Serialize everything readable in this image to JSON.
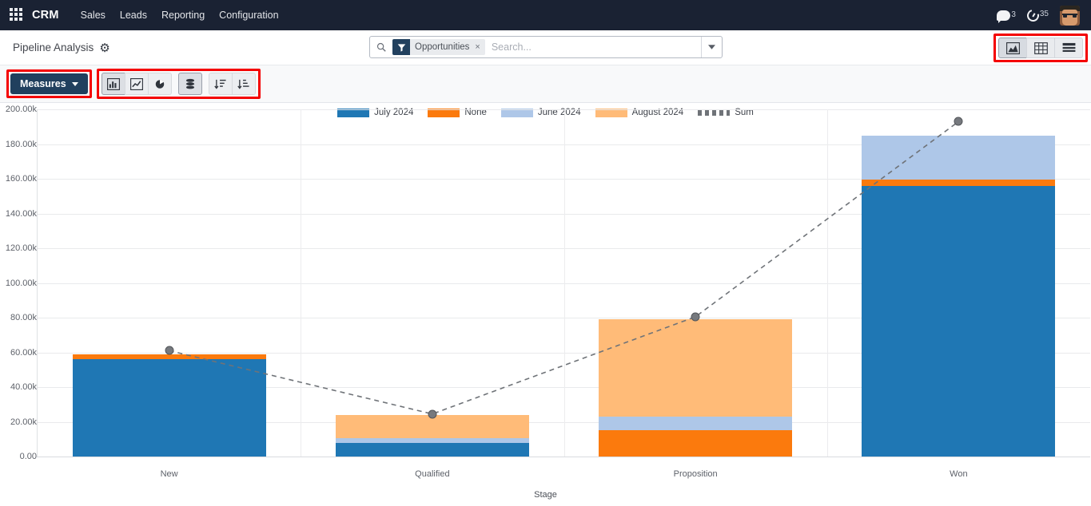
{
  "navbar": {
    "apps_icon": "apps-grid-icon",
    "brand": "CRM",
    "menu": [
      {
        "label": "Sales"
      },
      {
        "label": "Leads"
      },
      {
        "label": "Reporting"
      },
      {
        "label": "Configuration"
      }
    ],
    "messages_count": "3",
    "activities_count": "35"
  },
  "control_panel": {
    "title": "Pipeline Analysis",
    "settings_icon": "gear-icon",
    "search": {
      "facet_label": "Opportunities",
      "facet_icon": "filter-icon",
      "facet_remove": "×",
      "placeholder": "Search...",
      "value": ""
    },
    "views": [
      {
        "name": "graph",
        "icon": "area-chart-icon",
        "active": true
      },
      {
        "name": "pivot",
        "icon": "pivot-table-icon",
        "active": false
      },
      {
        "name": "list",
        "icon": "list-view-icon",
        "active": false
      }
    ]
  },
  "toolbar": {
    "measures_label": "Measures",
    "buttons": [
      {
        "name": "bar-chart",
        "icon": "bar-chart-icon",
        "active": true
      },
      {
        "name": "line-chart",
        "icon": "line-chart-icon",
        "active": false
      },
      {
        "name": "pie-chart",
        "icon": "pie-chart-icon",
        "active": false
      },
      {
        "name": "stacked",
        "icon": "database-stack-icon",
        "active": true
      },
      {
        "name": "sort-ascending",
        "icon": "sort-amount-asc-icon",
        "active": false
      },
      {
        "name": "sort-descending",
        "icon": "sort-amount-desc-icon",
        "active": false
      }
    ]
  },
  "colors": {
    "july_2024": "#1f77b4",
    "none": "#fb7a0d",
    "june_2024": "#aec7e8",
    "august_2024": "#ffbb78",
    "sum": "#6f7378",
    "brand_dark": "#1a2233",
    "accent": "#21405e",
    "highlight_outline": "#f40000"
  },
  "chart_data": {
    "type": "bar",
    "stacked": true,
    "title": "",
    "xlabel": "Stage",
    "ylabel": "",
    "categories": [
      "New",
      "Qualified",
      "Proposition",
      "Won"
    ],
    "ylim": [
      0,
      200000
    ],
    "yticks": [
      0,
      20000,
      40000,
      60000,
      80000,
      100000,
      120000,
      140000,
      160000,
      180000,
      200000
    ],
    "ytick_labels": [
      "0.00",
      "20.00k",
      "40.00k",
      "60.00k",
      "80.00k",
      "100.00k",
      "120.00k",
      "140.00k",
      "160.00k",
      "180.00k",
      "200.00k"
    ],
    "grid": true,
    "legend_position": "top",
    "series": [
      {
        "name": "July 2024",
        "color": "#1f77b4",
        "values": [
          56000,
          8000,
          0,
          156000
        ]
      },
      {
        "name": "None",
        "color": "#fb7a0d",
        "values": [
          3000,
          0,
          15000,
          3500
        ]
      },
      {
        "name": "June 2024",
        "color": "#aec7e8",
        "values": [
          0,
          2800,
          8000,
          25500
        ]
      },
      {
        "name": "August 2024",
        "color": "#ffbb78",
        "values": [
          0,
          13200,
          56000,
          0
        ]
      }
    ],
    "overlay": {
      "name": "Sum",
      "type": "line",
      "style": "dashed",
      "color": "#6f7378",
      "values": [
        61000,
        24500,
        80500,
        193000
      ]
    }
  }
}
